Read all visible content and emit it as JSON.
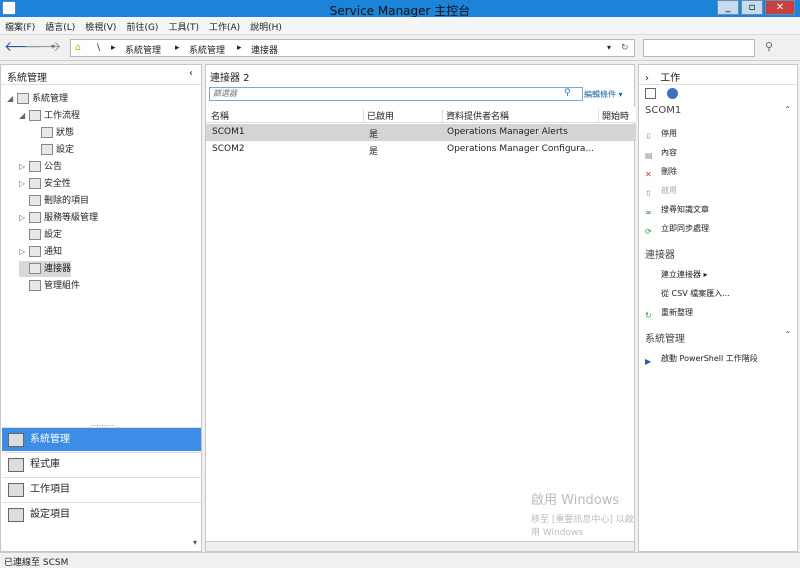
{
  "window": {
    "title": "Service Manager 主控台",
    "min": "_",
    "max": "▫",
    "close": "✕"
  },
  "menu": [
    "檔案(F)",
    "語言(L)",
    "檢視(V)",
    "前往(G)",
    "工具(T)",
    "工作(A)",
    "說明(H)"
  ],
  "address": {
    "root": "\\",
    "crumbs": [
      "系統管理",
      "系統管理",
      "連接器"
    ]
  },
  "left": {
    "title": "系統管理",
    "tree": [
      {
        "label": "系統管理",
        "indent": 0,
        "arrow": "◢"
      },
      {
        "label": "工作流程",
        "indent": 1,
        "arrow": "◢"
      },
      {
        "label": "狀態",
        "indent": 2,
        "arrow": ""
      },
      {
        "label": "設定",
        "indent": 2,
        "arrow": ""
      },
      {
        "label": "公告",
        "indent": 1,
        "arrow": "▷"
      },
      {
        "label": "安全性",
        "indent": 1,
        "arrow": "▷"
      },
      {
        "label": "刪除的項目",
        "indent": 1,
        "arrow": ""
      },
      {
        "label": "服務等級管理",
        "indent": 1,
        "arrow": "▷"
      },
      {
        "label": "設定",
        "indent": 1,
        "arrow": ""
      },
      {
        "label": "通知",
        "indent": 1,
        "arrow": "▷"
      },
      {
        "label": "連接器",
        "indent": 1,
        "arrow": ""
      },
      {
        "label": "管理組件",
        "indent": 1,
        "arrow": ""
      }
    ],
    "wunderbar": [
      "系統管理",
      "程式庫",
      "工作項目",
      "設定項目"
    ]
  },
  "center": {
    "title": "連接器 2",
    "filter_placeholder": "篩選器",
    "edit_criteria": "編輯條件 ▾",
    "columns": [
      "名稱",
      "已啟用",
      "資料提供者名稱",
      "開始時間"
    ],
    "rows": [
      [
        "SCOM1",
        "是",
        "Operations Manager Alerts"
      ],
      [
        "SCOM2",
        "是",
        "Operations Manager Configura..."
      ]
    ]
  },
  "right": {
    "title": "工作",
    "sections": [
      {
        "title": "SCOM1",
        "items": [
          {
            "label": "停用",
            "icon": "down-arrow-icon",
            "disabled": false
          },
          {
            "label": "內容",
            "icon": "properties-icon",
            "disabled": false
          },
          {
            "label": "刪除",
            "icon": "delete-icon",
            "disabled": false
          },
          {
            "label": "啟用",
            "icon": "up-arrow-icon",
            "disabled": true
          },
          {
            "label": "搜尋知識文章",
            "icon": "link-icon",
            "disabled": false
          },
          {
            "label": "立即同步處理",
            "icon": "sync-icon",
            "disabled": false
          }
        ]
      },
      {
        "title": "連接器",
        "items": [
          {
            "label": "建立連接器 ▸",
            "icon": "",
            "disabled": false
          },
          {
            "label": "從 CSV 檔案匯入...",
            "icon": "",
            "disabled": false
          },
          {
            "label": "重新整理",
            "icon": "refresh-icon",
            "disabled": false
          }
        ]
      },
      {
        "title": "系統管理",
        "items": [
          {
            "label": "啟動 PowerShell 工作階段",
            "icon": "powershell-icon",
            "disabled": false
          }
        ]
      }
    ]
  },
  "status": "已連線至 SCSM",
  "watermark": {
    "line1": "啟用 Windows",
    "line2": "移至 [重要訊息中心] 以啟用 Windows"
  }
}
